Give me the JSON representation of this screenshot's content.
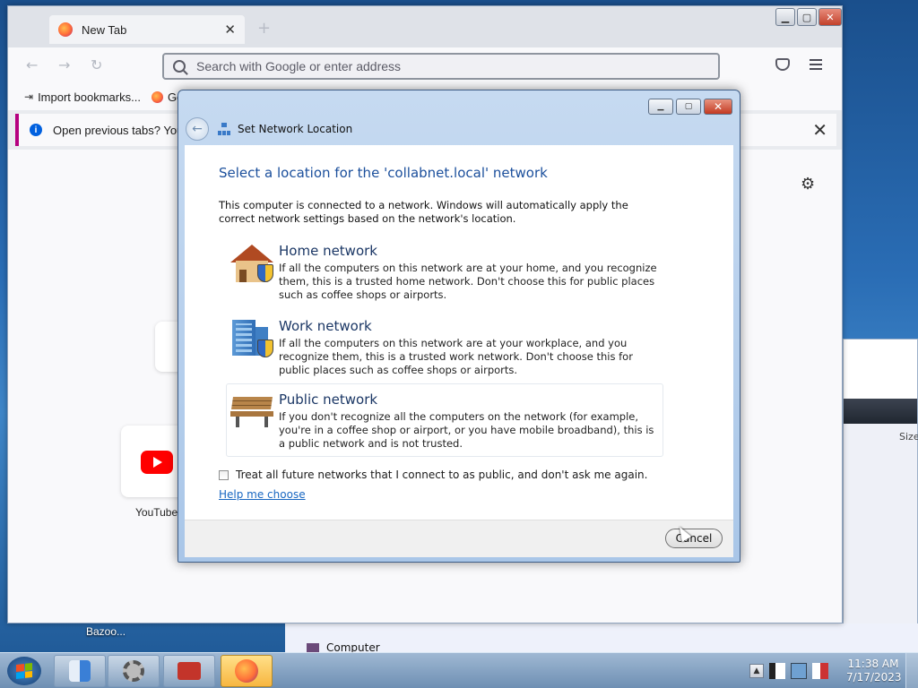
{
  "browser": {
    "tab_title": "New Tab",
    "new_tab_glyph": "+",
    "address_placeholder": "Search with Google or enter address",
    "bookmarks": [
      {
        "label": "Import bookmarks...",
        "icon": "import-icon"
      },
      {
        "label": "Ge",
        "icon": "firefox-icon"
      }
    ],
    "notice_text": "Open previous tabs? You ca",
    "shortcuts": [
      {
        "label": "YouTube",
        "icon": "youtube-icon"
      }
    ]
  },
  "dialog": {
    "title": "Set Network Location",
    "heading": "Select a location for the 'collabnet.local' network",
    "intro": "This computer is connected to a network. Windows will automatically apply the correct network settings based on the network's location.",
    "options": [
      {
        "title": "Home network",
        "description": "If all the computers on this network are at your home, and you recognize them, this is a trusted home network.  Don't choose this for public places such as coffee shops or airports.",
        "icon": "home-network-icon"
      },
      {
        "title": "Work network",
        "description": "If all the computers on this network are at your workplace, and you recognize them, this is a trusted work network.  Don't choose this for public places such as coffee shops or airports.",
        "icon": "work-network-icon"
      },
      {
        "title": "Public network",
        "description": "If you don't recognize all the computers on the network (for example, you're in a coffee shop or airport, or you have mobile broadband), this is a public network and is not trusted.",
        "icon": "public-network-icon"
      }
    ],
    "checkbox_label": "Treat all future networks that I connect to as public, and don't ask me again.",
    "checkbox_checked": false,
    "help_link": "Help me choose",
    "cancel_label": "Cancel"
  },
  "background": {
    "explorer_size_header": "Size",
    "computer_label": "Computer",
    "desktop_label": "Bazoo..."
  },
  "taskbar": {
    "time": "11:38 AM",
    "date": "7/17/2023",
    "apps": [
      {
        "name": "finder",
        "active": false
      },
      {
        "name": "system-preferences",
        "active": false
      },
      {
        "name": "toolbox",
        "active": false
      },
      {
        "name": "firefox",
        "active": true
      }
    ]
  },
  "colors": {
    "dialog_heading": "#1b4f9c",
    "link": "#1766c1",
    "notice_accent": "#b5007f",
    "taskbar_active": "#f7b640"
  }
}
